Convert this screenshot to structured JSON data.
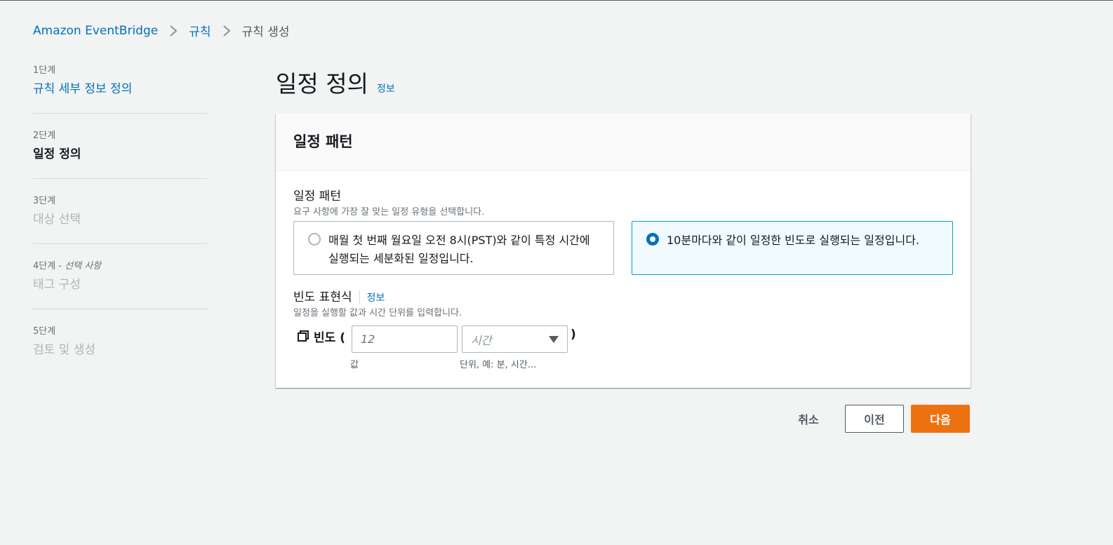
{
  "breadcrumb": {
    "items": [
      "Amazon EventBridge",
      "규칙",
      "규칙 생성"
    ]
  },
  "steps": [
    {
      "num": "1단계",
      "title": "규칙 세부 정보 정의",
      "state": "done"
    },
    {
      "num": "2단계",
      "title": "일정 정의",
      "state": "active"
    },
    {
      "num": "3단계",
      "title": "대상 선택",
      "state": "disabled"
    },
    {
      "num": "4단계",
      "num_suffix": "선택 사항",
      "title": "태그 구성",
      "state": "disabled"
    },
    {
      "num": "5단계",
      "title": "검토 및 생성",
      "state": "disabled"
    }
  ],
  "page": {
    "title": "일정 정의",
    "info": "정보"
  },
  "panel": {
    "header": "일정 패턴",
    "pattern_label": "일정 패턴",
    "pattern_desc": "요구 사항에 가장 잘 맞는 일정 유형을 선택합니다.",
    "options": [
      {
        "text": "매월 첫 번째 월요일 오전 8시(PST)와 같이 특정 시간에 실행되는 세분화된 일정입니다.",
        "selected": false
      },
      {
        "text": "10분마다와 같이 일정한 빈도로 실행되는 일정입니다.",
        "selected": true
      }
    ],
    "rate_label": "빈도 표현식",
    "rate_info": "정보",
    "rate_desc": "일정을 실행할 값과 시간 단위를 입력합니다.",
    "rate_prefix": "빈도 (",
    "rate_suffix": ")",
    "value_placeholder": "12",
    "unit_placeholder": "시간",
    "value_sublabel": "값",
    "unit_sublabel": "단위, 예: 분, 시간..."
  },
  "footer": {
    "cancel": "취소",
    "previous": "이전",
    "next": "다음"
  },
  "colors": {
    "link": "#0073bb",
    "primary": "#ec7211",
    "selected_border": "#00a1c9",
    "selected_bg": "#f1faff"
  }
}
